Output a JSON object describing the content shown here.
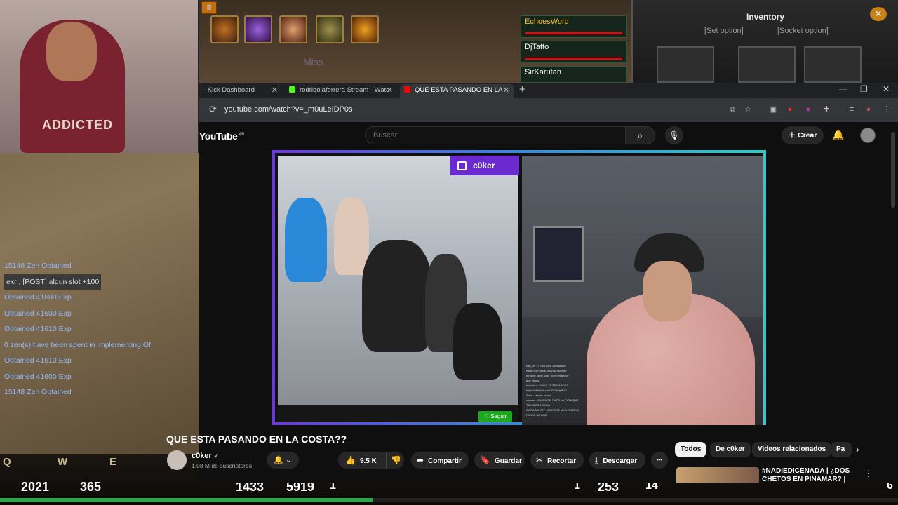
{
  "game": {
    "pause_label": "II",
    "miss_text": "Miss",
    "party": [
      {
        "name": "EchoesWord",
        "color": "#f0c020"
      },
      {
        "name": "DjTatto",
        "color": "#ffffff"
      },
      {
        "name": "SirKarutan",
        "color": "#ffffff"
      }
    ],
    "inventory": {
      "title": "Inventory",
      "set_option": "[Set option]",
      "socket_option": "[Socket option]",
      "close_label": "✕"
    },
    "chatlog": [
      "15148 Zen Obtained",
      "exr , [POST] algun slot +100",
      "Obtained 41600 Exp",
      "Obtained 41600 Exp",
      "Obtained 41610 Exp",
      "0 zen(s) have been spent in implementing Of",
      "Obtained 41610 Exp",
      "Obtained 41600 Exp",
      "15148 Zen Obtained"
    ],
    "hud": {
      "keys": [
        "Q",
        "W",
        "E"
      ],
      "hp_potions": "2021",
      "mana_potions": "365",
      "stats": [
        "1433",
        "5919",
        "1",
        "1",
        "253",
        "14",
        "6"
      ],
      "xp_fraction": 0.415
    },
    "webcam_shirt_text": "ADDICTED"
  },
  "browser": {
    "tabs": [
      {
        "label": "- Kick Dashboard",
        "favicon_color": "#2a2a2a"
      },
      {
        "label": "rodrigolaferrera Stream - Watc",
        "favicon_color": "#53fc18"
      },
      {
        "label": "QUE ESTA PASANDO EN LA",
        "favicon_color": "#ff0000",
        "active": true
      }
    ],
    "new_tab": "+",
    "window_controls": {
      "minimize": "—",
      "maximize": "❐",
      "close": "✕"
    },
    "url": "youtube.com/watch?v=_m0uLeIDP0s",
    "reload_icon": "⟳"
  },
  "youtube": {
    "logo": "YouTube",
    "region": "AR",
    "search_placeholder": "Buscar",
    "create_label": "Crear",
    "player": {
      "twitch_channel": "c0ker",
      "follow_label": "♡ Seguir",
      "clip_chat_lines": [
        "roki_09 : TEMA DEL VERANO!!!",
        "https://vm.tiktok.com/ZMSkqwfn/",
        "fernand_arch_yyk : ncesl majecce",
        "que veses",
        "elcholoo : COCO TE PEGARON?",
        "https://vt.tiktok.com/ZSSn9pfKG/",
        "Zhad : vikosc ccoas",
        "naboso : CUIQUITO PUTO LA PUTA QUE",
        "TE PARIOOOOOO",
        "CORAZON777 : COCO TE VA A TENER Q",
        "PARAR DE ANO"
      ]
    },
    "video": {
      "title": "QUE ESTA PASANDO EN LA COSTA??",
      "channel": "c0ker",
      "subscribers": "1.08 M de suscriptores",
      "likes": "9.5 K",
      "share": "Compartir",
      "save": "Guardar",
      "clip": "Recortar",
      "download": "Descargar",
      "more": "•••"
    },
    "chips": [
      "Todos",
      "De c0ker",
      "Videos relacionados",
      "Pa"
    ],
    "recommendation": {
      "title": "#NADIEDICENADA | ¿DOS CHETOS EN PINAMAR? |"
    }
  }
}
